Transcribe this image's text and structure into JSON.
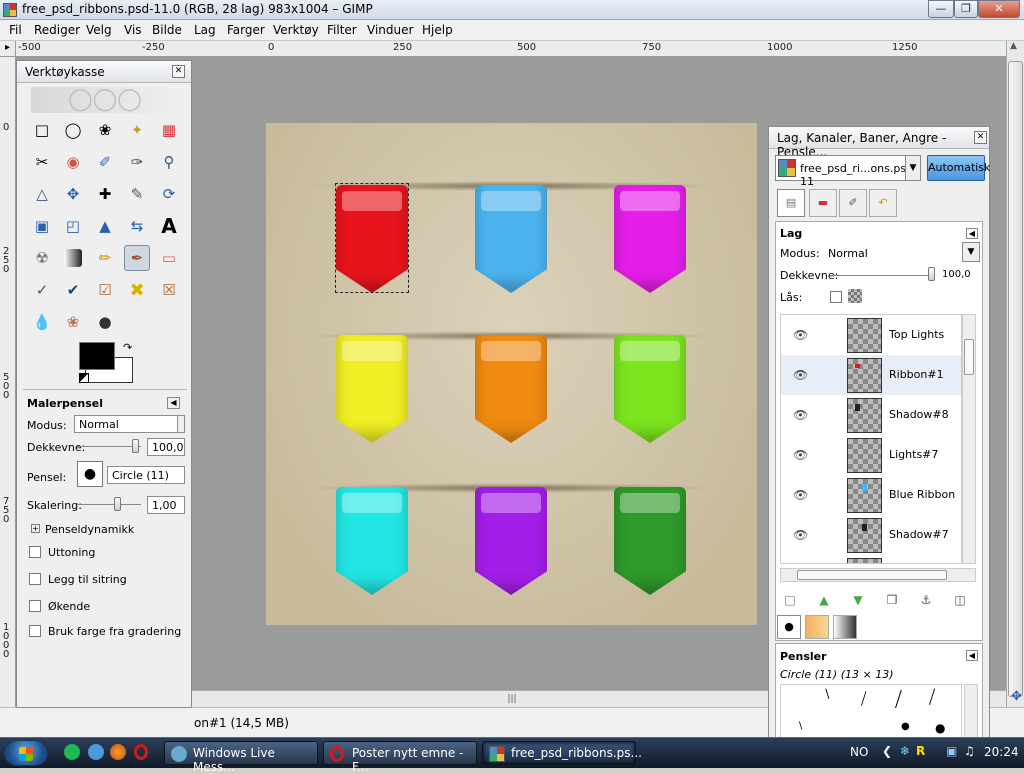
{
  "window": {
    "title": "free_psd_ribbons.psd-11.0 (RGB, 28 lag) 983x1004 – GIMP"
  },
  "menu": [
    "Fil",
    "Rediger",
    "Velg",
    "Vis",
    "Bilde",
    "Lag",
    "Farger",
    "Verktøy",
    "Filter",
    "Vinduer",
    "Hjelp"
  ],
  "ruler_top": [
    "-500",
    "-250",
    "0",
    "250",
    "500",
    "750",
    "1000",
    "1250"
  ],
  "ruler_left": [
    "0",
    "2\n5\n0",
    "5\n0\n0",
    "7\n5\n0",
    "1\n0\n0\n0"
  ],
  "toolbox": {
    "title": "Verktøykasse",
    "tool_options_title": "Malerpensel",
    "mode_label": "Modus:",
    "mode_value": "Normal",
    "opacity_label": "Dekkevne:",
    "opacity_value": "100,0",
    "brush_label": "Pensel:",
    "brush_value": "Circle (11)",
    "scale_label": "Skalering:",
    "scale_value": "1,00",
    "dynamics_label": "Penseldynamikk",
    "checkboxes": [
      "Uttoning",
      "Legg til sitring",
      "Økende",
      "Bruk farge fra gradering"
    ]
  },
  "layers_dock": {
    "title": "Lag, Kanaler, Baner, Angre - Pensle...",
    "image_select": "free_psd_ri...ons.psd-11",
    "auto_button": "Automatisk",
    "section_title": "Lag",
    "mode_label": "Modus:",
    "mode_value": "Normal",
    "opacity_label": "Dekkevne:",
    "opacity_value": "100,0",
    "lock_label": "Lås:",
    "layers": [
      "Top Lights",
      "Ribbon#1",
      "Shadow#8",
      "Lights#7",
      "Blue Ribbon",
      "Shadow#7"
    ],
    "brushes_title": "Pensler",
    "brushes_sub": "Circle (11) (13 × 13)"
  },
  "status": {
    "text": "on#1 (14,5 MB)"
  },
  "taskbar": {
    "tasks": [
      "Windows Live Mess...",
      "Poster nytt emne - F...",
      "free_psd_ribbons.ps..."
    ],
    "lang": "NO",
    "clock": "20:24"
  },
  "ribbon_colors": [
    "#e8141c",
    "#4cb3ef",
    "#e51ee8",
    "#f0ef25",
    "#f08a10",
    "#7ce51e",
    "#22e6e3",
    "#a31ee8",
    "#2e9a2a"
  ]
}
